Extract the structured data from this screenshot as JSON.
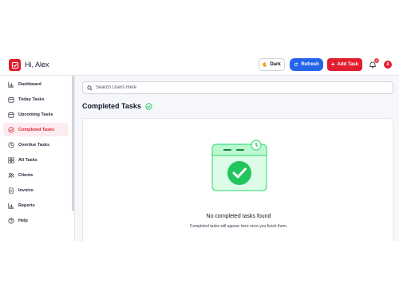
{
  "header": {
    "greeting": "Hi, Alex",
    "theme_label": "Dark",
    "refresh_label": "Refresh",
    "add_task_label": "Add Task",
    "notification_count": "1",
    "avatar_initial": "A"
  },
  "sidebar": {
    "items": [
      {
        "label": "Dashboard",
        "icon": "bar-chart-icon"
      },
      {
        "label": "Today Tasks",
        "icon": "calendar-icon"
      },
      {
        "label": "Upcoming Tasks",
        "icon": "calendar-icon"
      },
      {
        "label": "Completed Tasks",
        "icon": "check-circle-icon",
        "active": true
      },
      {
        "label": "Overdue Tasks",
        "icon": "clock-icon"
      },
      {
        "label": "All Tasks",
        "icon": "grid-icon"
      },
      {
        "label": "Clients",
        "icon": "users-icon"
      },
      {
        "label": "Invoice",
        "icon": "document-icon"
      },
      {
        "label": "Reports",
        "icon": "bar-chart-icon"
      },
      {
        "label": "Help",
        "icon": "help-icon"
      }
    ]
  },
  "search": {
    "placeholder": "Search Users Here"
  },
  "main": {
    "title": "Completed Tasks",
    "empty_title": "No completed tasks found",
    "empty_subtitle": "Completed tasks will appear here once you finish them."
  },
  "colors": {
    "brand": "#e11d2e",
    "accent_blue": "#2563eb",
    "success": "#22c55e"
  }
}
